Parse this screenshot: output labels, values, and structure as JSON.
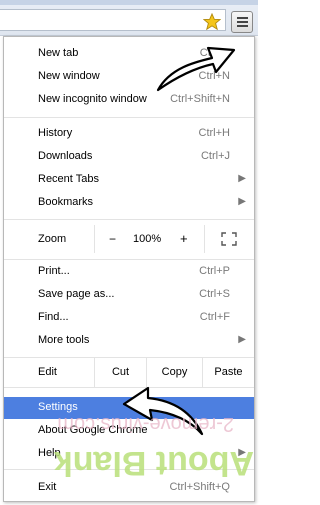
{
  "menu": {
    "group1": [
      {
        "label": "New tab",
        "shortcut": "Ctrl+T"
      },
      {
        "label": "New window",
        "shortcut": "Ctrl+N"
      },
      {
        "label": "New incognito window",
        "shortcut": "Ctrl+Shift+N"
      }
    ],
    "group2": [
      {
        "label": "History",
        "shortcut": "Ctrl+H"
      },
      {
        "label": "Downloads",
        "shortcut": "Ctrl+J"
      },
      {
        "label": "Recent Tabs",
        "shortcut": ""
      },
      {
        "label": "Bookmarks",
        "shortcut": ""
      }
    ],
    "zoom": {
      "label": "Zoom",
      "minus": "−",
      "value": "100%",
      "plus": "+"
    },
    "group3": [
      {
        "label": "Print...",
        "shortcut": "Ctrl+P"
      },
      {
        "label": "Save page as...",
        "shortcut": "Ctrl+S"
      },
      {
        "label": "Find...",
        "shortcut": "Ctrl+F"
      },
      {
        "label": "More tools",
        "shortcut": ""
      }
    ],
    "edit": {
      "label": "Edit",
      "cut": "Cut",
      "copy": "Copy",
      "paste": "Paste"
    },
    "group4": [
      {
        "label": "Settings",
        "shortcut": ""
      },
      {
        "label": "About Google Chrome",
        "shortcut": ""
      },
      {
        "label": "Help",
        "shortcut": ""
      }
    ],
    "exit": {
      "label": "Exit",
      "shortcut": "Ctrl+Shift+Q"
    }
  },
  "watermark": {
    "line1": "About Blank",
    "line2": "2-remove-virus.com"
  },
  "colors": {
    "highlight": "#4d7fe0",
    "watermark": "#b9e07a",
    "star": "#f5c518"
  }
}
